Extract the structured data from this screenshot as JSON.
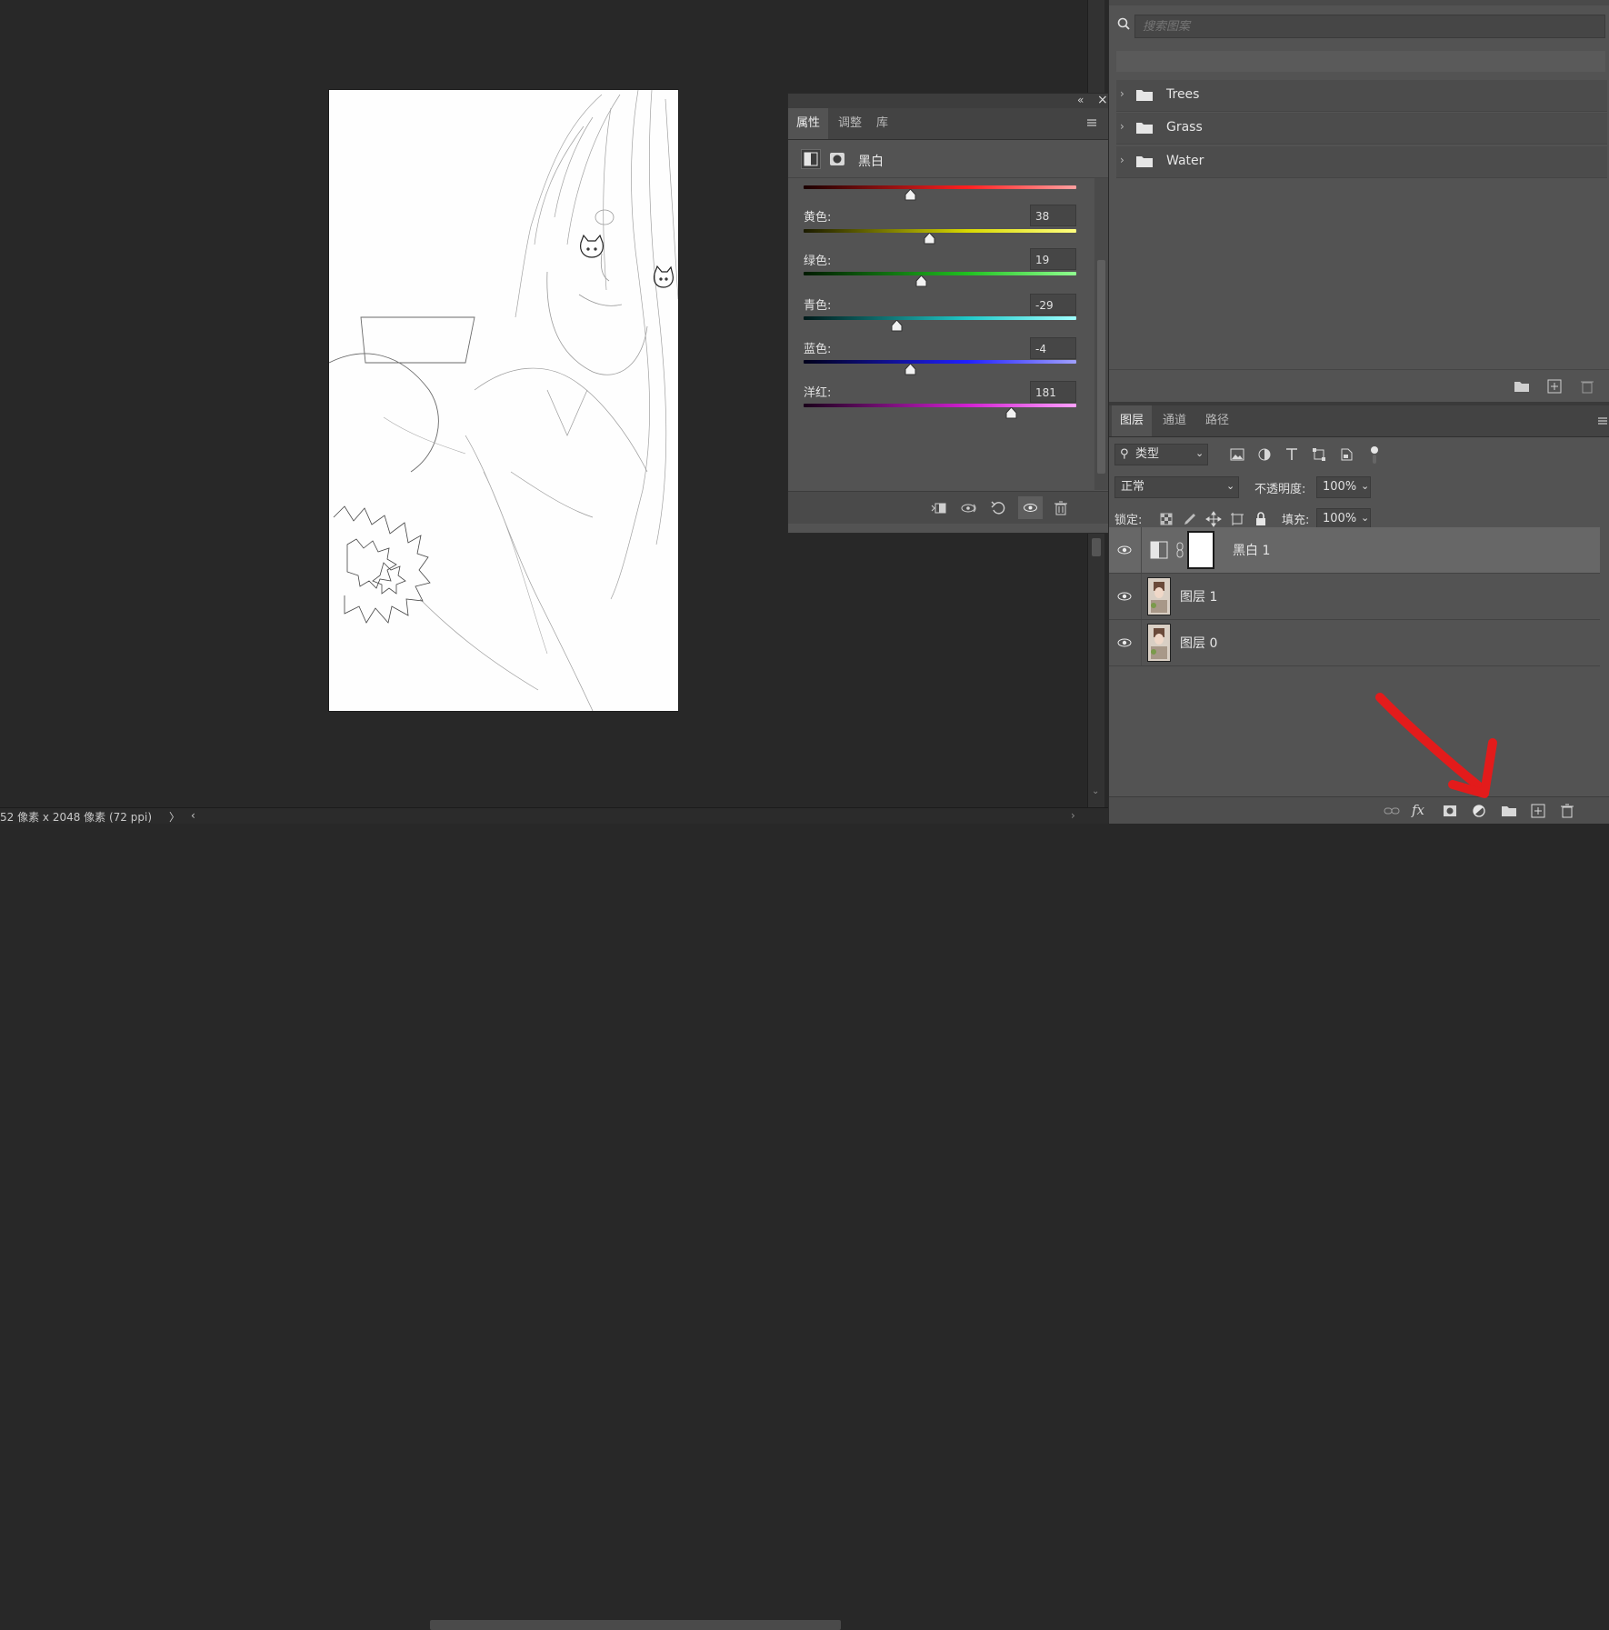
{
  "status": {
    "doc_info": "52 像素 x 2048 像素 (72 ppi)",
    "arrow_left": "〉",
    "arrow_right": "‹"
  },
  "properties_panel": {
    "collapse_glyph": "«",
    "close_glyph": "×",
    "tabs": [
      {
        "label": "属性",
        "active": true
      },
      {
        "label": "调整",
        "active": false
      },
      {
        "label": "库",
        "active": false
      }
    ],
    "adjustment_title": "黑白",
    "sliders": [
      {
        "label": "",
        "value": "",
        "level": 0.39,
        "gradient": "red"
      },
      {
        "label": "黄色:",
        "value": "38",
        "level": 0.46,
        "gradient": "yellow"
      },
      {
        "label": "绿色:",
        "value": "19",
        "level": 0.43,
        "gradient": "green"
      },
      {
        "label": "青色:",
        "value": "-29",
        "level": 0.34,
        "gradient": "cyan"
      },
      {
        "label": "蓝色:",
        "value": "-4",
        "level": 0.39,
        "gradient": "blue"
      },
      {
        "label": "洋红:",
        "value": "181",
        "level": 0.76,
        "gradient": "magenta"
      }
    ]
  },
  "patterns_panel": {
    "search_placeholder": "搜索图案",
    "groups": [
      {
        "label": "Trees"
      },
      {
        "label": "Grass"
      },
      {
        "label": "Water"
      }
    ]
  },
  "layers_panel": {
    "tabs": [
      {
        "label": "图层",
        "active": true
      },
      {
        "label": "通道",
        "active": false
      },
      {
        "label": "路径",
        "active": false
      }
    ],
    "filter_kind": "类型",
    "blend_mode": "正常",
    "opacity_label": "不透明度:",
    "opacity_value": "100%",
    "lock_label": "锁定:",
    "fill_label": "填充:",
    "fill_value": "100%",
    "layers": [
      {
        "name": "黑白 1",
        "selected": true,
        "kind": "adjustment"
      },
      {
        "name": "图层 1",
        "selected": false,
        "kind": "pixel"
      },
      {
        "name": "图层 0",
        "selected": false,
        "kind": "pixel"
      }
    ]
  },
  "annotation": {
    "color": "#e31b1b",
    "points_to": "adjustment-layer-button"
  },
  "colors": {
    "panel": "#535353",
    "dark": "#282828",
    "selected_layer": "#676767"
  }
}
